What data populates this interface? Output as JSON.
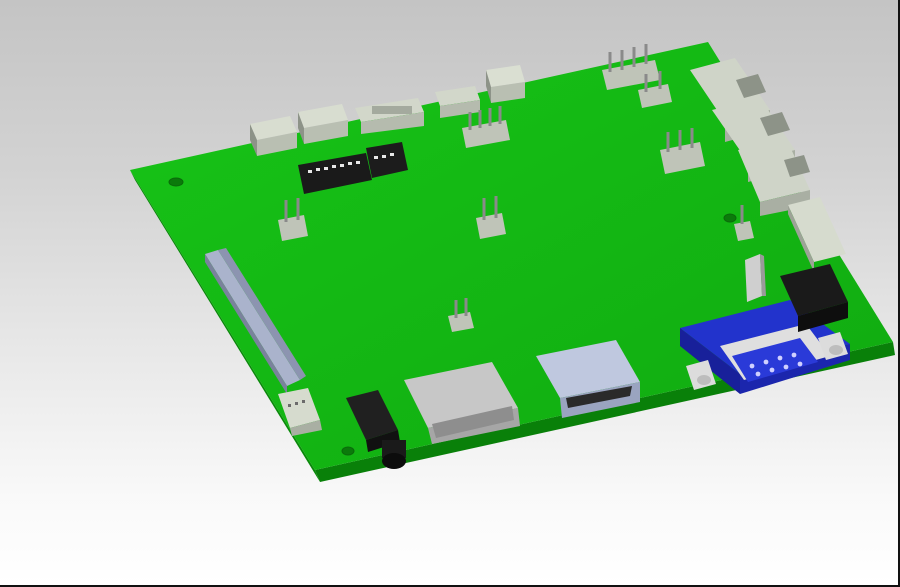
{
  "scene": {
    "subject": "pcb-board-3d-model",
    "background": {
      "top": "#c4c4c4",
      "bottom": "#ffffff"
    },
    "colors": {
      "board_top": "#10b810",
      "board_edge": "#0a8a0a",
      "board_edge_front": "#098009",
      "connector_light": "#d6dccd",
      "connector_mid": "#b9bfb2",
      "connector_dark": "#8d9388",
      "header_black": "#1a1a1a",
      "pin_metal": "#c4c4c4",
      "vga_blue": "#2233cc",
      "vga_blue_dark": "#18209a",
      "socket_gray": "#aab3cc",
      "shield_silver": "#d6d6d6"
    },
    "components": [
      "header-connector",
      "dip-switch",
      "pin-header",
      "ethernet-jack",
      "card-slot",
      "audio-jack",
      "sd-card-slot",
      "hdmi-port",
      "vga-port",
      "dc-power-jack",
      "mounting-hole"
    ]
  }
}
